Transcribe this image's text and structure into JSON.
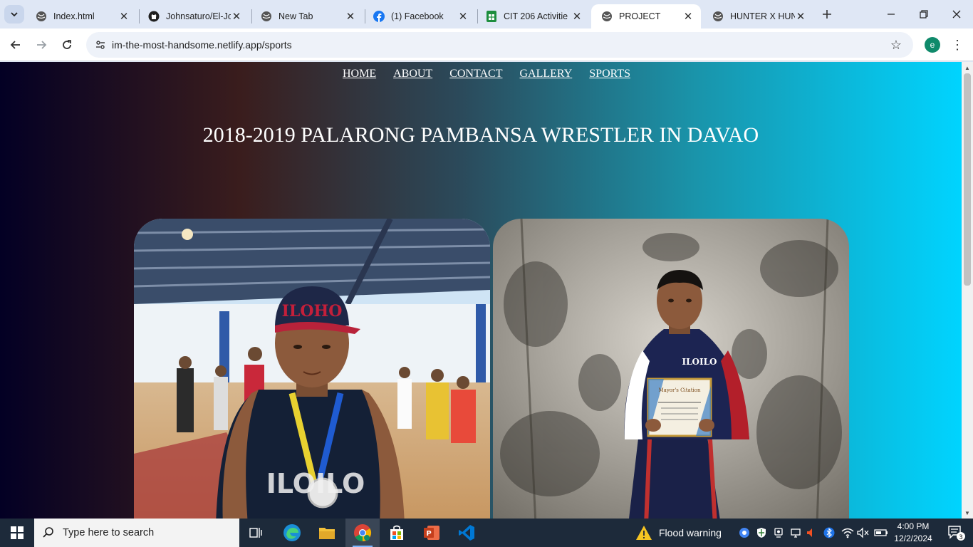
{
  "browser": {
    "tabs": [
      {
        "title": "Index.html",
        "icon": "globe-icon",
        "active": false
      },
      {
        "title": "Johnsaturo/El-Jo",
        "icon": "github-icon",
        "active": false
      },
      {
        "title": "New Tab",
        "icon": "globe-icon",
        "active": false
      },
      {
        "title": "(1) Facebook",
        "icon": "facebook-icon",
        "active": false
      },
      {
        "title": "CIT 206 Activitie",
        "icon": "sheets-icon",
        "active": false
      },
      {
        "title": "PROJECT",
        "icon": "globe-icon",
        "active": true
      },
      {
        "title": "HUNTER X HUN",
        "icon": "globe-icon",
        "active": false
      }
    ],
    "url": "im-the-most-handsome.netlify.app/sports",
    "profile_initial": "e"
  },
  "page": {
    "nav": [
      {
        "label": "HOME"
      },
      {
        "label": "ABOUT"
      },
      {
        "label": "CONTACT"
      },
      {
        "label": "GALLERY"
      },
      {
        "label": "SPORTS"
      }
    ],
    "heading": "2018-2019 PALARONG PAMBANSA WRESTLER IN DAVAO",
    "photos": [
      {
        "cap_text": "ILOHO",
        "jersey_text": "ILOILO"
      },
      {
        "jacket_text": "ILOILO",
        "certificate_title": "Mayor's Citation"
      }
    ]
  },
  "taskbar": {
    "search_placeholder": "Type here to search",
    "weather": "Flood warning",
    "time": "4:00 PM",
    "date": "12/2/2024",
    "notification_count": "3"
  }
}
